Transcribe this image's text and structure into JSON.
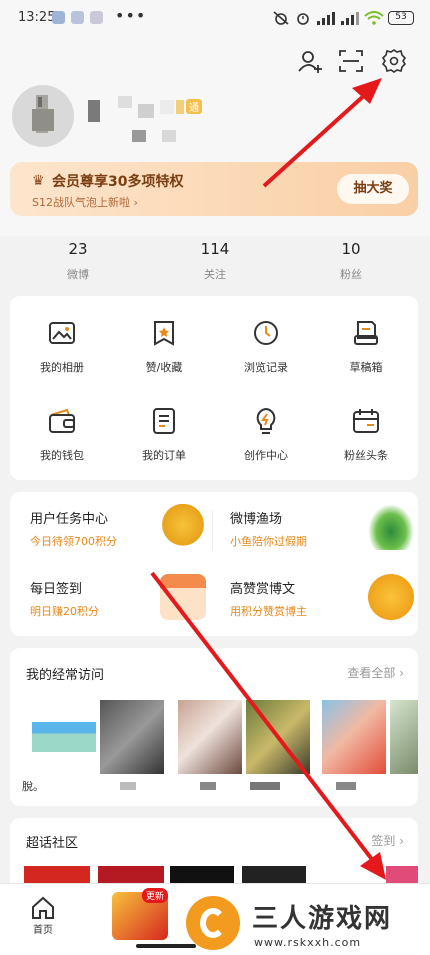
{
  "status_bar": {
    "time": "13:25",
    "battery": "53",
    "signal_tag_1": "HD",
    "signal_tag_2": "HD"
  },
  "vip": {
    "title": "会员尊享30多项特权",
    "subtitle": "S12战队气泡上新啦 ›",
    "button": "抽大奖"
  },
  "profile": {
    "badge": "通"
  },
  "stats": [
    {
      "value": "23",
      "label": "微博"
    },
    {
      "value": "114",
      "label": "关注"
    },
    {
      "value": "10",
      "label": "粉丝"
    }
  ],
  "grid": [
    {
      "label": "我的相册",
      "icon": "album-icon"
    },
    {
      "label": "赞/收藏",
      "icon": "like-favorite-icon"
    },
    {
      "label": "浏览记录",
      "icon": "history-icon"
    },
    {
      "label": "草稿箱",
      "icon": "drafts-icon"
    },
    {
      "label": "我的钱包",
      "icon": "wallet-icon"
    },
    {
      "label": "我的订单",
      "icon": "orders-icon"
    },
    {
      "label": "创作中心",
      "icon": "creator-bulb-icon"
    },
    {
      "label": "粉丝头条",
      "icon": "fans-headline-icon"
    }
  ],
  "tasks": [
    {
      "title": "用户任务中心",
      "subtitle": "今日待领700积分"
    },
    {
      "title": "微博渔场",
      "subtitle": "小鱼陪你过假期"
    },
    {
      "title": "每日签到",
      "subtitle": "明日赚20积分"
    },
    {
      "title": "高赞赏博文",
      "subtitle": "用积分赞赏博主"
    }
  ],
  "frequent": {
    "title": "我的经常访问",
    "more": "查看全部",
    "first_label": "脫。"
  },
  "supertopic": {
    "title": "超话社区",
    "more": "签到"
  },
  "tabbar": {
    "home": "首页",
    "new_badge": "更新"
  },
  "watermark": {
    "name": "三人游戏网",
    "url": "www.rskxxh.com"
  },
  "colors": {
    "accent_orange": "#e8891a",
    "arrow_red": "#e3191c",
    "vip_text": "#7a3e12"
  }
}
